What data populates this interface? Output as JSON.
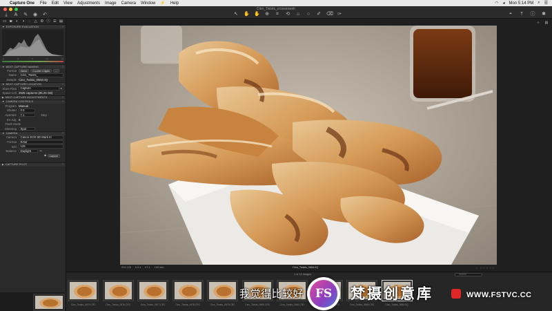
{
  "menubar": {
    "app_name": "Capture One",
    "items": [
      "File",
      "Edit",
      "View",
      "Adjustments",
      "Image",
      "Camera",
      "Window",
      "Help"
    ],
    "clock": "Mon 5:14 PM"
  },
  "window": {
    "title": "Cinn_Twists_crossesweb"
  },
  "left_panel": {
    "exposure_evaluation": {
      "header": "EXPOSURE EVALUATION",
      "scale": [
        "-2",
        "-1",
        "0",
        "+1",
        "+2"
      ]
    },
    "next_capture_naming": {
      "header": "NEXT CAPTURE NAMING",
      "format_label": "Format",
      "format_buttons": [
        "Name",
        "Counter 4 digits",
        "..."
      ],
      "name_label": "Name",
      "name_value": "Cinn_Twists_",
      "sample_label": "Sample",
      "sample_value": "Cinn_Twists_0684.IIQ"
    },
    "next_capture_location": {
      "header": "NEXT CAPTURE LOCATION",
      "store_files_label": "Store Files",
      "store_files_value": "Capture",
      "space_left_label": "Space Left",
      "space_left_value": "2925 captures (85.25 GB)"
    },
    "next_capture_adjustments": {
      "header": "NEXT CAPTURE ADJUSTMENTS"
    },
    "camera_controls": {
      "header": "CAMERA CONTROLS",
      "rows": [
        {
          "label": "Program",
          "value": "Manual"
        },
        {
          "label": "Shutter",
          "value": "0.5"
        },
        {
          "label": "Aperture",
          "value": "7.1"
        },
        {
          "label": "EV Adj.",
          "value": "0"
        },
        {
          "label": "Flash Mode",
          "value": ""
        },
        {
          "label": "Metering",
          "value": "Spot"
        }
      ],
      "step_label": "Step"
    },
    "camera": {
      "header": "CAMERA",
      "rows": [
        {
          "label": "Camera",
          "value": "Canon EOS 5D Mark III"
        },
        {
          "label": "Format",
          "value": "RAW"
        },
        {
          "label": "ISO",
          "value": "125"
        },
        {
          "label": "Balance",
          "value": "Daylight"
        }
      ],
      "capture_button": "Capture"
    },
    "capture_pilot": {
      "header": "CAPTURE PILOT"
    }
  },
  "viewer": {
    "photo_meta": [
      "ISO 125",
      "0.5 s",
      "f/7.1",
      "100 mm"
    ],
    "photo_filename": "Cinn_Twists_0684.IIQ"
  },
  "browser": {
    "count": "1 of 15 Images",
    "search_placeholder": "Search",
    "thumbnails": [
      "Cinn_Twists_0670.CR2",
      "Cinn_Twists_0676.CR2",
      "Cinn_Twists_0677.CR2",
      "Cinn_Twists_0678.CR2",
      "Cinn_Twists_0679.CR2",
      "Cinn_Twists_0680.CR2",
      "Cinn_Twists_0681.CR2",
      "Cinn_Twists_0682.CR2",
      "Cinn_Twists_0683.CR2",
      "Cinn_Twists_0684.IIQ"
    ]
  },
  "overlay": {
    "subtitle": "我觉得比较好",
    "watermark_logo": "FS",
    "watermark_text": "梵摄创意库",
    "watermark_url": "WWW.FSTVC.CC"
  },
  "colors": {
    "panel_bg": "#2a2a2a",
    "viewer_bg": "#1f1f1f",
    "accent_red": "#e02727",
    "traffic_red": "#fc5f57",
    "traffic_yellow": "#fdbc2e",
    "traffic_green": "#33c748"
  }
}
